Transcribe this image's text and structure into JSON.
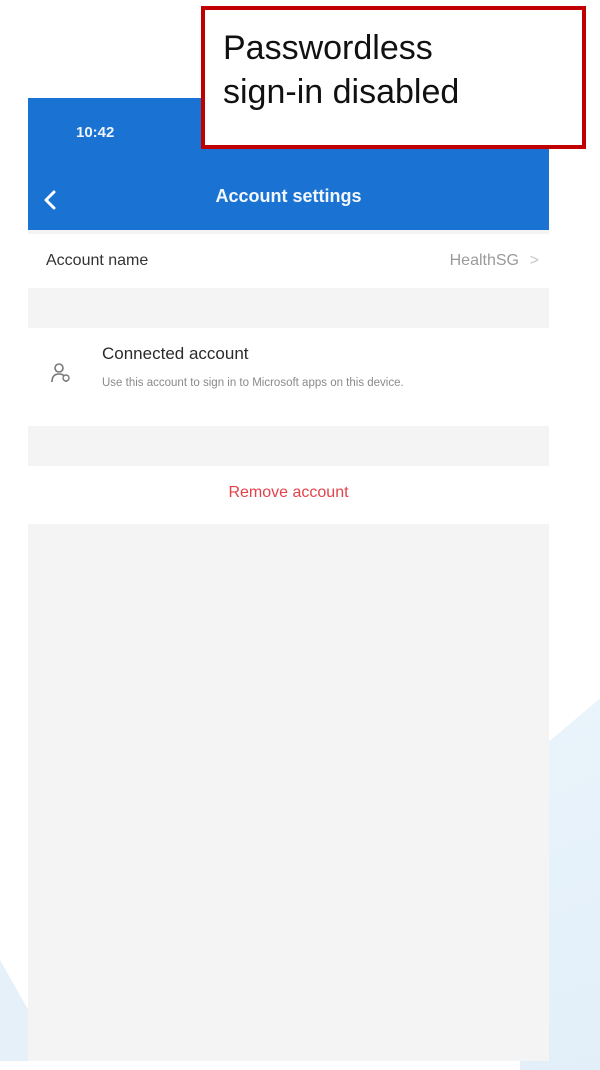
{
  "callout": {
    "line1": "Passwordless",
    "line2": "sign-in disabled",
    "border_color": "#c00000"
  },
  "status_bar": {
    "time": "10:42"
  },
  "header": {
    "title": "Account settings",
    "back_icon": "chevron-left-icon",
    "background": "#1a73d2"
  },
  "account_name": {
    "label": "Account name",
    "value": "HealthSG",
    "chevron": ">"
  },
  "connected_account": {
    "icon": "person-icon",
    "title": "Connected account",
    "description": "Use this account to sign in to Microsoft apps on this device."
  },
  "remove_account": {
    "label": "Remove account",
    "color": "#e2434a"
  }
}
